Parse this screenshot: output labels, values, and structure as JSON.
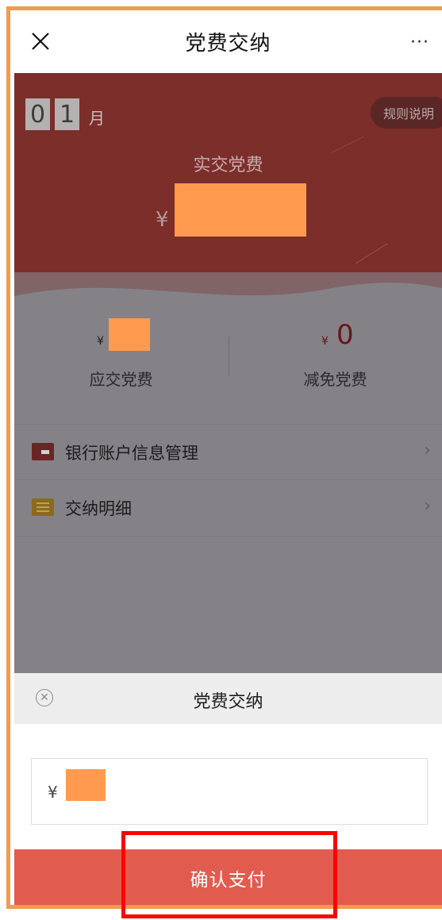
{
  "header": {
    "title": "党费交纳",
    "close_icon": "close-icon",
    "more_label": "···"
  },
  "hero": {
    "month_digits": [
      "0",
      "1"
    ],
    "month_unit": "月",
    "rules_label": "规则说明",
    "paid_label": "实交党费",
    "currency": "¥"
  },
  "stats": {
    "due": {
      "currency": "¥",
      "label": "应交党费"
    },
    "reduced": {
      "currency": "¥",
      "value": "0",
      "label": "减免党费"
    }
  },
  "menu": [
    {
      "label": "银行账户信息管理",
      "icon": "bank-card-icon"
    },
    {
      "label": "交纳明细",
      "icon": "list-icon"
    }
  ],
  "sheet": {
    "title": "党费交纳",
    "currency": "¥",
    "confirm_label": "确认支付"
  },
  "colors": {
    "accent": "#e25b4f",
    "hero_bg": "#7c2e2b",
    "redaction": "#ff9a4f",
    "highlight": "#ff0000"
  }
}
